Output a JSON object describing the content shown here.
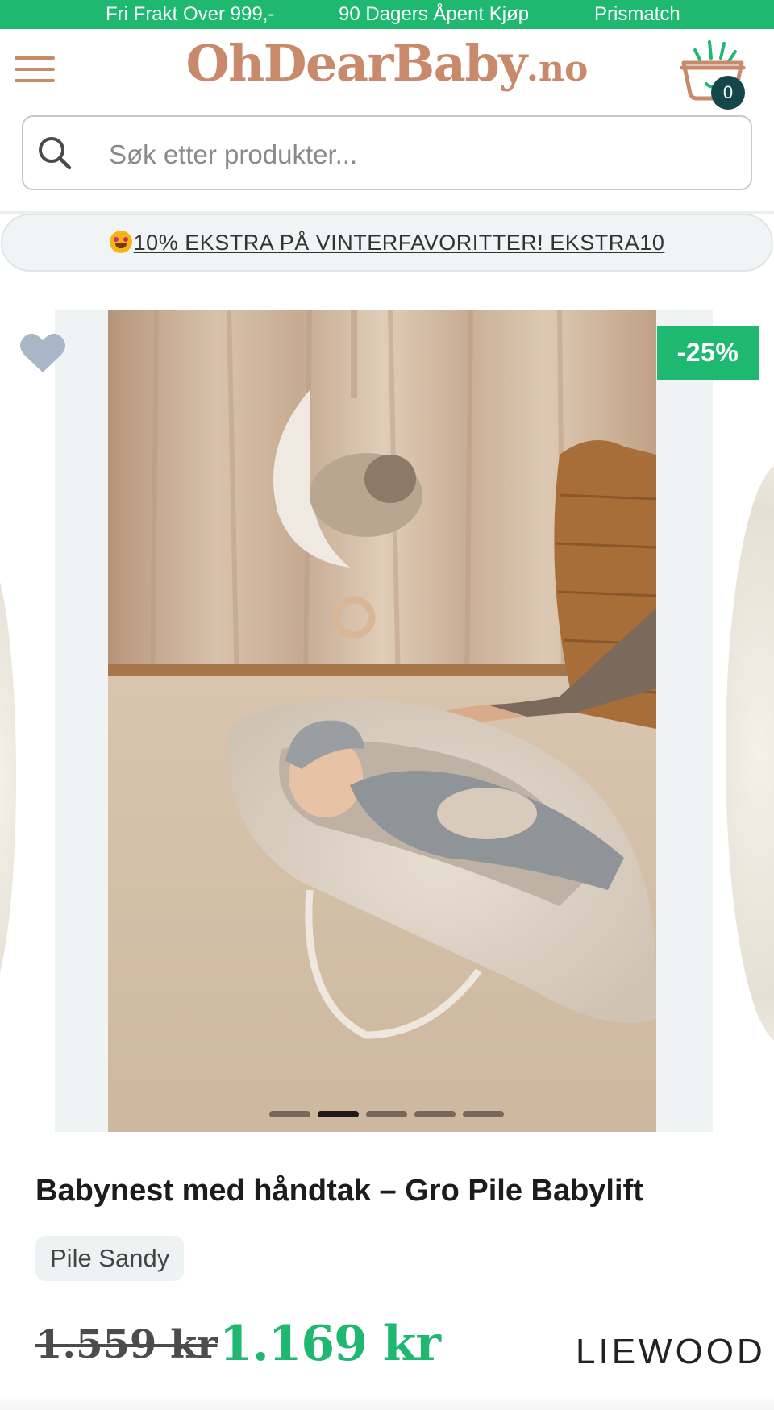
{
  "topbar": {
    "items": [
      "Fri Frakt Over 999,-",
      "90 Dagers Åpent Kjøp",
      "Prismatch"
    ],
    "color": "#1fb871"
  },
  "header": {
    "logo_main": "OhDearBaby",
    "logo_suffix": ".no",
    "menu_icon": "hamburger-icon",
    "cart_icon": "shopping-basket-icon",
    "cart_count": "0",
    "brand_color": "#c98a6c"
  },
  "search": {
    "placeholder": "Søk etter produkter...",
    "icon": "search-icon"
  },
  "promo": {
    "emoji": "star-struck-emoji",
    "text": "10% EKSTRA PÅ VINTERFAVORITTER! EKSTRA10"
  },
  "gallery": {
    "discount_badge": "-25%",
    "wishlist_icon": "heart-icon",
    "slide_count": 5,
    "active_slide": 2,
    "image_description": "baby lying in a babynest with handles under a moon mobile"
  },
  "product": {
    "title": "Babynest med håndtak – Gro Pile Babylift",
    "variant": "Pile Sandy",
    "old_price": "1.559 kr",
    "price": "1.169 kr",
    "brand": "LIEWOOD",
    "price_color": "#1fb871"
  }
}
